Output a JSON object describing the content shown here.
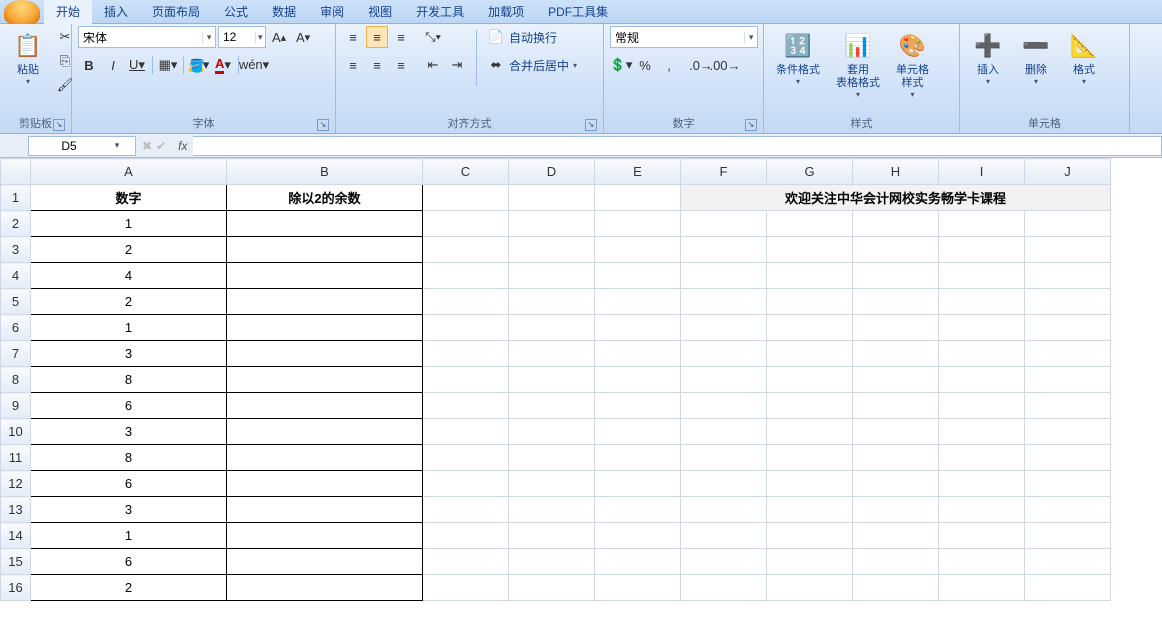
{
  "tabs": [
    "开始",
    "插入",
    "页面布局",
    "公式",
    "数据",
    "审阅",
    "视图",
    "开发工具",
    "加载项",
    "PDF工具集"
  ],
  "activeTab": 0,
  "groups": {
    "clipboard": {
      "label": "剪贴板",
      "paste": "粘贴"
    },
    "font": {
      "label": "字体",
      "name": "宋体",
      "size": "12"
    },
    "align": {
      "label": "对齐方式",
      "wrap": "自动换行",
      "merge": "合并后居中"
    },
    "number": {
      "label": "数字",
      "format": "常规"
    },
    "styles": {
      "label": "样式",
      "cond": "条件格式",
      "table": "套用\n表格格式",
      "cell": "单元格\n样式"
    },
    "cells": {
      "label": "单元格",
      "insert": "插入",
      "delete": "删除",
      "format": "格式"
    }
  },
  "namebox": "D5",
  "formula": "",
  "columns": [
    "A",
    "B",
    "C",
    "D",
    "E",
    "F",
    "G",
    "H",
    "I",
    "J"
  ],
  "headers": {
    "A": "数字",
    "B": "除以2的余数"
  },
  "banner": "欢迎关注中华会计网校实务畅学卡课程",
  "rows": [
    {
      "n": 1,
      "A": "数字",
      "B": "除以2的余数",
      "hdr": true
    },
    {
      "n": 2,
      "A": "1"
    },
    {
      "n": 3,
      "A": "2"
    },
    {
      "n": 4,
      "A": "4"
    },
    {
      "n": 5,
      "A": "2"
    },
    {
      "n": 6,
      "A": "1"
    },
    {
      "n": 7,
      "A": "3"
    },
    {
      "n": 8,
      "A": "8"
    },
    {
      "n": 9,
      "A": "6"
    },
    {
      "n": 10,
      "A": "3"
    },
    {
      "n": 11,
      "A": "8"
    },
    {
      "n": 12,
      "A": "6"
    },
    {
      "n": 13,
      "A": "3"
    },
    {
      "n": 14,
      "A": "1"
    },
    {
      "n": 15,
      "A": "6"
    },
    {
      "n": 16,
      "A": "2"
    }
  ]
}
